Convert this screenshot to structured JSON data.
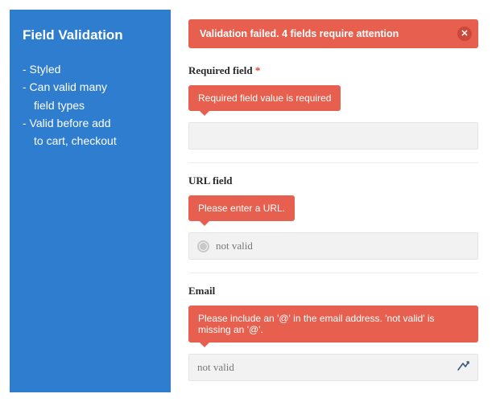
{
  "sidebar": {
    "title": "Field Validation",
    "lines": [
      "- Styled",
      "- Can valid many",
      "field types",
      "- Valid before add",
      "to cart, checkout"
    ],
    "lineIndent": [
      false,
      false,
      true,
      false,
      true
    ]
  },
  "alert": {
    "message": "Validation failed. 4 fields require attention",
    "close": "✕"
  },
  "fields": {
    "required": {
      "label": "Required field",
      "star": "*",
      "tip": "Required field value is required",
      "value": ""
    },
    "url": {
      "label": "URL field",
      "tip": "Please enter a URL.",
      "value": "not valid"
    },
    "email": {
      "label": "Email",
      "tip": "Please include an '@' in the email address. 'not valid' is missing an '@'.",
      "value": "not valid"
    }
  }
}
